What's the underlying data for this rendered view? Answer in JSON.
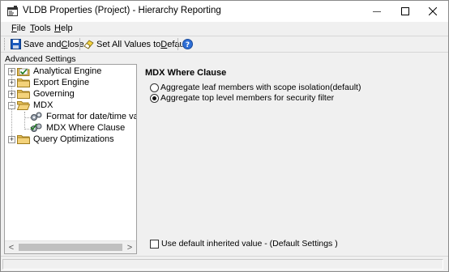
{
  "window": {
    "title": "VLDB Properties (Project) - Hierarchy Reporting"
  },
  "menu": {
    "file": {
      "key": "F",
      "rest": "ile"
    },
    "tools": {
      "key": "T",
      "rest": "ools"
    },
    "help": {
      "key": "H",
      "rest": "elp"
    }
  },
  "toolbar": {
    "save_close_pre": "Save and ",
    "save_close_key": "C",
    "save_close_post": "lose",
    "set_defaults_pre": "Set All Values to ",
    "set_defaults_key": "D",
    "set_defaults_post": "efault",
    "help_icon": "help-icon"
  },
  "section_label": "Advanced Settings",
  "tree": {
    "items": [
      {
        "label": "Analytical Engine",
        "icon": "folder-checked-icon",
        "expander": "+"
      },
      {
        "label": "Export Engine",
        "icon": "folder-icon",
        "expander": "+"
      },
      {
        "label": "Governing",
        "icon": "folder-icon",
        "expander": "+"
      },
      {
        "label": "MDX",
        "icon": "folder-open-icon",
        "expander": "−"
      },
      {
        "label": "Format for date/time values",
        "icon": "gears-icon"
      },
      {
        "label": "MDX Where Clause",
        "icon": "gears-checked-icon"
      },
      {
        "label": "Query Optimizations",
        "icon": "folder-icon",
        "expander": "+"
      }
    ]
  },
  "main": {
    "title": "MDX Where Clause",
    "options": [
      {
        "label": "Aggregate leaf members with scope isolation(default)",
        "checked": false
      },
      {
        "label": "Aggregate top level members for security filter",
        "checked": true
      }
    ],
    "use_default": {
      "label": "Use default inherited value - (Default Settings )",
      "checked": false
    }
  },
  "colors": {
    "folder": "#e8c15a",
    "accent": "#1c5bbd"
  }
}
